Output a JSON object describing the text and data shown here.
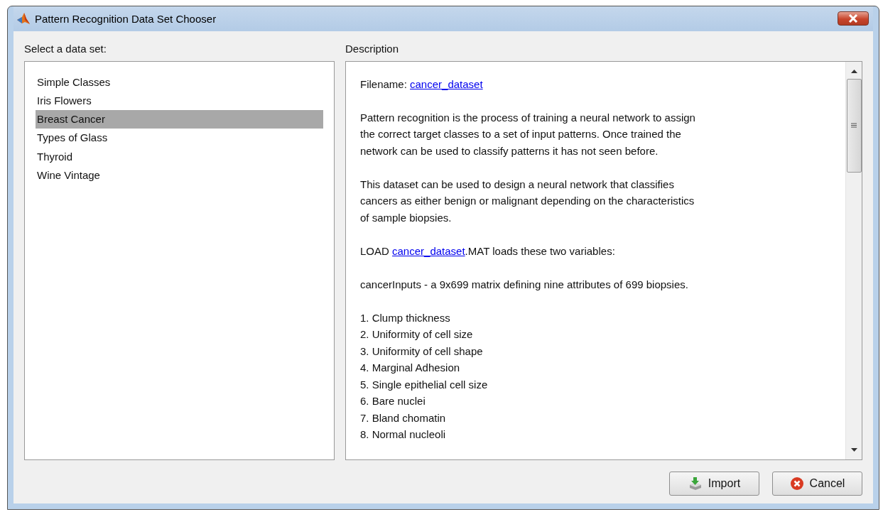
{
  "window": {
    "title": "Pattern Recognition Data Set Chooser"
  },
  "list_label": "Select a data set:",
  "datasets": [
    {
      "label": "Simple Classes",
      "selected": false
    },
    {
      "label": "Iris Flowers",
      "selected": false
    },
    {
      "label": "Breast Cancer",
      "selected": true
    },
    {
      "label": "Types of Glass",
      "selected": false
    },
    {
      "label": "Thyroid",
      "selected": false
    },
    {
      "label": "Wine Vintage",
      "selected": false
    }
  ],
  "description_label": "Description",
  "description": [
    {
      "kind": "link",
      "before": "Filename: ",
      "link": "cancer_dataset"
    },
    {
      "kind": "text",
      "lines": [
        "Pattern recognition is the process of training a neural network to assign",
        "the correct target classes to a set of input patterns. Once trained the",
        "network can be used to classify patterns it has not seen before."
      ]
    },
    {
      "kind": "text",
      "lines": [
        "This dataset can be used to design a neural network that classifies",
        "cancers as either benign or malignant depending on the characteristics",
        "of sample biopsies."
      ]
    },
    {
      "kind": "link",
      "before": "LOAD ",
      "link": "cancer_dataset",
      "after": ".MAT loads these two variables:"
    },
    {
      "kind": "text",
      "lines": [
        "cancerInputs - a 9x699 matrix defining nine attributes of 699 biopsies."
      ]
    },
    {
      "kind": "list",
      "items": [
        "1. Clump thickness",
        "2. Uniformity of cell size",
        "3. Uniformity of cell shape",
        "4. Marginal Adhesion",
        "5. Single epithelial cell size",
        "6. Bare nuclei",
        "7. Bland chomatin",
        "8. Normal nucleoli"
      ]
    }
  ],
  "buttons": [
    {
      "kind": "import",
      "label": "Import"
    },
    {
      "kind": "cancel",
      "label": "Cancel"
    }
  ]
}
